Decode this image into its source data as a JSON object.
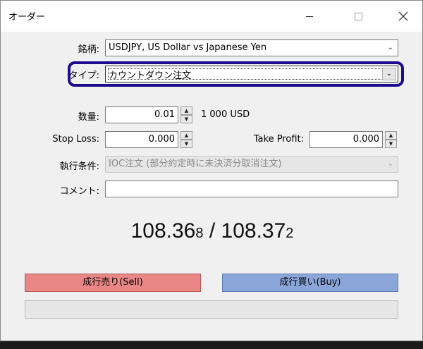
{
  "window": {
    "title": "オーダー",
    "minimize_icon": "minimize-icon",
    "maximize_icon": "maximize-icon",
    "close_icon": "close-icon"
  },
  "form": {
    "symbol": {
      "label": "銘柄:",
      "value": "USDJPY, US Dollar vs Japanese Yen"
    },
    "type": {
      "label": "タイプ:",
      "value": "カウントダウン注文"
    },
    "volume": {
      "label": "数量:",
      "value": "0.01",
      "unit": "1 000 USD"
    },
    "stop_loss": {
      "label": "Stop Loss:",
      "value": "0.000"
    },
    "take_profit": {
      "label": "Take Profit:",
      "value": "0.000"
    },
    "execution": {
      "label": "執行条件:",
      "value": "IOC注文 (部分約定時に未決済分取消注文)"
    },
    "comment": {
      "label": "コメント:",
      "value": ""
    }
  },
  "quote": {
    "bid_main": "108.36",
    "bid_small": "8",
    "separator": "/",
    "ask_main": "108.37",
    "ask_small": "2"
  },
  "buttons": {
    "sell": "成行売り(Sell)",
    "buy": "成行買い(Buy)"
  },
  "colors": {
    "highlight_ring": "#1c0a8f",
    "sell": "#e98686",
    "buy": "#8aa6d9"
  }
}
